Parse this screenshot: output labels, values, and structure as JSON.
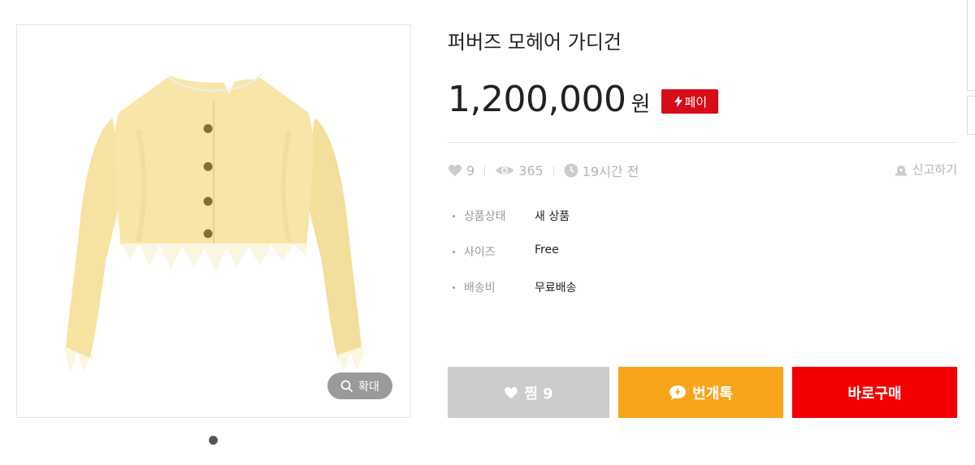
{
  "product": {
    "title": "퍼버즈 모헤어 가디건",
    "price": "1,200,000",
    "currency": "원",
    "pay_badge": "페이",
    "image_icon": "cardigan-image",
    "zoom_label": "확대"
  },
  "stats": {
    "likes": "9",
    "views": "365",
    "time": "19시간 전",
    "report_label": "신고하기"
  },
  "details": [
    {
      "label": "상품상태",
      "value": "새 상품"
    },
    {
      "label": "사이즈",
      "value": "Free"
    },
    {
      "label": "배송비",
      "value": "무료배송"
    }
  ],
  "actions": {
    "like_label": "찜 9",
    "chat_label": "번개톡",
    "buy_label": "바로구매"
  },
  "colors": {
    "pay_red": "#d80c18",
    "like_gray": "#cccccc",
    "chat_orange": "#f8a51c",
    "buy_red": "#f50000"
  }
}
